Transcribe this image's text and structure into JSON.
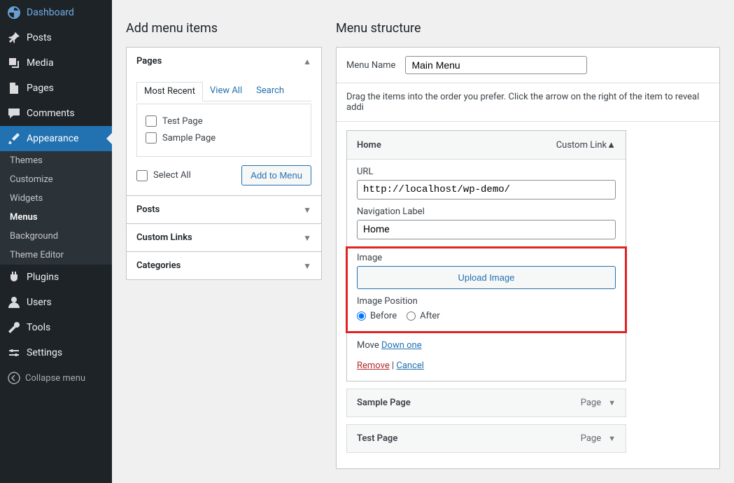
{
  "sidebar": {
    "items": [
      {
        "id": "dashboard",
        "label": "Dashboard"
      },
      {
        "id": "posts",
        "label": "Posts"
      },
      {
        "id": "media",
        "label": "Media"
      },
      {
        "id": "pages",
        "label": "Pages"
      },
      {
        "id": "comments",
        "label": "Comments"
      },
      {
        "id": "appearance",
        "label": "Appearance"
      },
      {
        "id": "plugins",
        "label": "Plugins"
      },
      {
        "id": "users",
        "label": "Users"
      },
      {
        "id": "tools",
        "label": "Tools"
      },
      {
        "id": "settings",
        "label": "Settings"
      }
    ],
    "submenu": {
      "items": [
        "Themes",
        "Customize",
        "Widgets",
        "Menus",
        "Background",
        "Theme Editor"
      ],
      "current": "Menus"
    },
    "collapse": "Collapse menu"
  },
  "add": {
    "title": "Add menu items",
    "sections": {
      "pages": "Pages",
      "posts": "Posts",
      "custom": "Custom Links",
      "categories": "Categories"
    },
    "tabs": {
      "recent": "Most Recent",
      "viewall": "View All",
      "search": "Search"
    },
    "pageItems": [
      "Test Page",
      "Sample Page"
    ],
    "selectAll": "Select All",
    "addBtn": "Add to Menu"
  },
  "structure": {
    "title": "Menu structure",
    "menuNameLabel": "Menu Name",
    "menuName": "Main Menu",
    "helper": "Drag the items into the order you prefer. Click the arrow on the right of the item to reveal addi",
    "item": {
      "title": "Home",
      "type": "Custom Link",
      "urlLabel": "URL",
      "url": "http://localhost/wp-demo/",
      "navLabel": "Navigation Label",
      "navValue": "Home",
      "imageLabel": "Image",
      "uploadLabel": "Upload Image",
      "positionLabel": "Image Position",
      "before": "Before",
      "after": "After",
      "moveLabel": "Move",
      "moveDown": "Down one",
      "remove": "Remove",
      "cancel": "Cancel"
    },
    "others": [
      {
        "title": "Sample Page",
        "type": "Page"
      },
      {
        "title": "Test Page",
        "type": "Page"
      }
    ]
  }
}
